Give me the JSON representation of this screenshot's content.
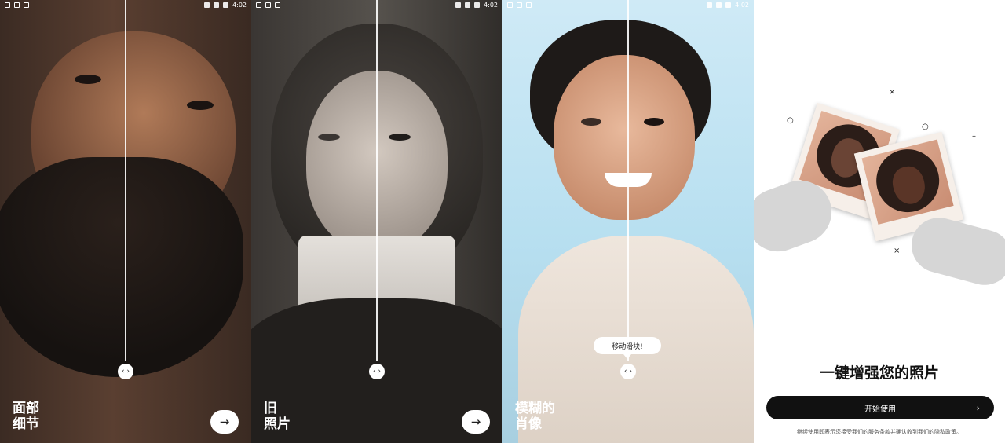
{
  "status_bar": {
    "time": "4:02"
  },
  "screens": [
    {
      "title_line1": "面部",
      "title_line2": "细节",
      "next_icon": "→"
    },
    {
      "title_line1": "旧",
      "title_line2": "照片",
      "next_icon": "→"
    },
    {
      "title_line1": "模糊的",
      "title_line2": "肖像",
      "tooltip": "移动滑块!"
    }
  ],
  "slider_handle_icon": "‹ ›",
  "welcome": {
    "heading": "一键增强您的照片",
    "button_label": "开始使用",
    "button_icon": "›",
    "terms": "继续使用即表示您接受我们的服务条款并确认收到我们的隐私政策。"
  },
  "decor_symbols": {
    "cross": "×",
    "circle": "○",
    "dash": "–"
  }
}
